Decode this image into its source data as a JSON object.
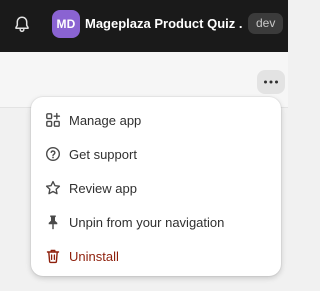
{
  "topbar": {
    "avatar_initials": "MD",
    "app_title": "Mageplaza Product Quiz ...",
    "env_badge": "dev"
  },
  "menu": {
    "items": [
      {
        "label": "Manage app",
        "icon": "manage-app-icon"
      },
      {
        "label": "Get support",
        "icon": "question-circle-icon"
      },
      {
        "label": "Review app",
        "icon": "star-icon"
      },
      {
        "label": "Unpin from your navigation",
        "icon": "pin-icon"
      },
      {
        "label": "Uninstall",
        "icon": "trash-icon",
        "tone": "critical"
      }
    ]
  },
  "colors": {
    "topbar_bg": "#1a1a1a",
    "avatar_bg": "#8a63d2",
    "critical_text": "#8e1f0b"
  }
}
